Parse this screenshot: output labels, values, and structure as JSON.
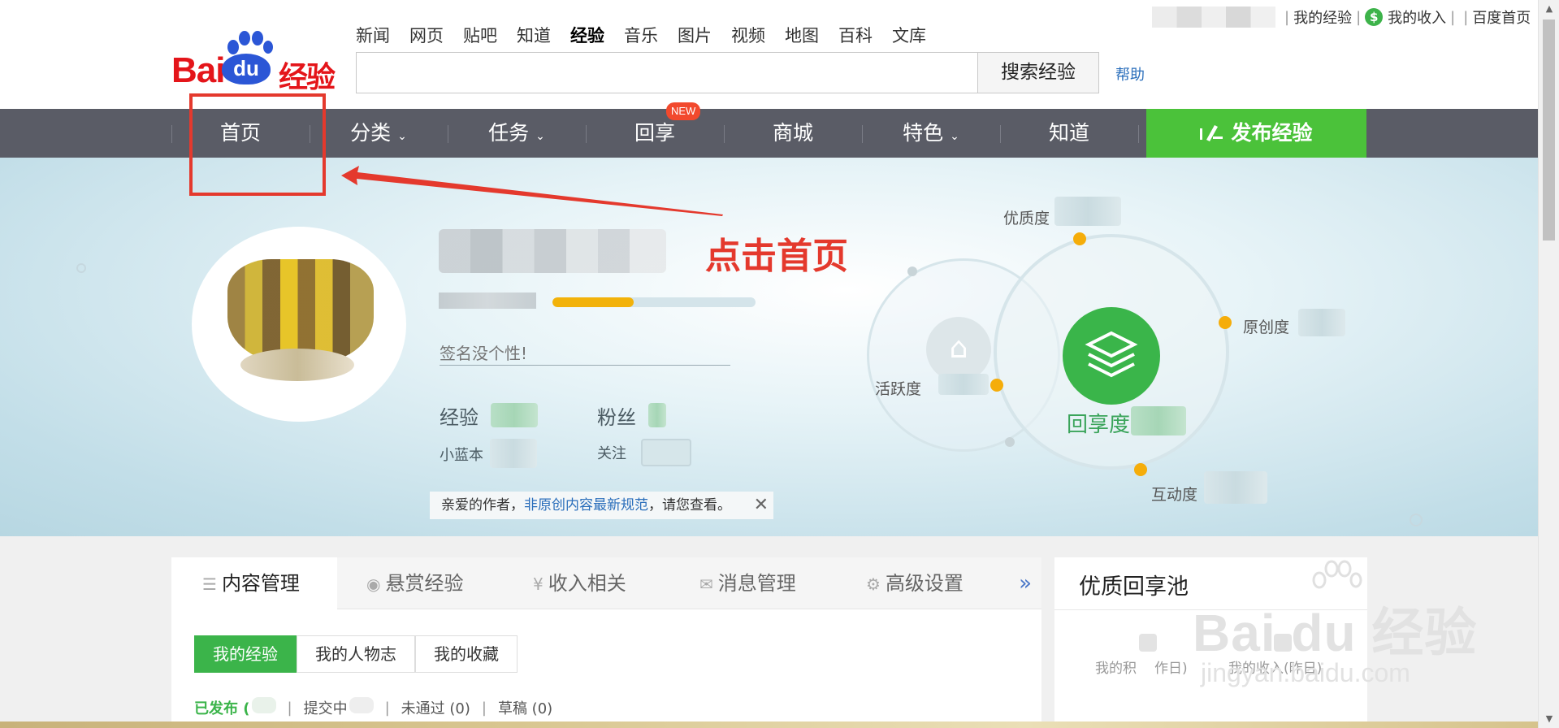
{
  "header": {
    "logo_bai": "Bai",
    "logo_du": "du",
    "logo_jingyan": "经验",
    "top_nav": [
      "新闻",
      "网页",
      "贴吧",
      "知道",
      "经验",
      "音乐",
      "图片",
      "视频",
      "地图",
      "百科",
      "文库"
    ],
    "active_top_nav": "经验",
    "search_placeholder": "",
    "search_button": "搜索经验",
    "help_link": "帮助",
    "user_links": {
      "my_experience": "我的经验",
      "my_income": "我的收入",
      "baidu_home": "百度首页",
      "dollar_glyph": "$"
    }
  },
  "main_nav": {
    "items": [
      "首页",
      "分类",
      "任务",
      "回享",
      "商城",
      "特色",
      "知道"
    ],
    "new_badge": "NEW",
    "publish_button": "发布经验"
  },
  "profile": {
    "level_progress_percent": 40,
    "signature_placeholder": "签名没个性!",
    "experience_label": "经验",
    "fans_label": "粉丝",
    "notebook_label": "小蓝本",
    "follow_label": "关注",
    "notice_prefix": "亲爱的作者，",
    "notice_link": "非原创内容最新规范",
    "notice_suffix": "，请您查看。",
    "notice_close": "✕"
  },
  "annotation": {
    "text": "点击首页"
  },
  "orbit": {
    "quality": "优质度",
    "originality": "原创度",
    "activity": "活跃度",
    "interaction": "互动度",
    "center": "回享度"
  },
  "content_panel": {
    "tabs": [
      "内容管理",
      "悬赏经验",
      "收入相关",
      "消息管理",
      "高级设置"
    ],
    "tab_icons": [
      "☰",
      "◉",
      "¥",
      "✉",
      "⚙"
    ],
    "more": "»",
    "subtabs": [
      "我的经验",
      "我的人物志",
      "我的收藏"
    ],
    "filters": {
      "published": "已发布 (",
      "submitting": "提交中",
      "rejected": "未通过 (0)",
      "draft": "草稿 (0)"
    }
  },
  "pool_panel": {
    "title": "优质回享池",
    "stat_left": "我的积",
    "stat_left_suffix": "作日)",
    "stat_right": "我的收入(昨日)"
  },
  "watermark": {
    "line1": "Bai du 经验",
    "line2": "jingyan.baidu.com"
  },
  "colors": {
    "nav_bg": "#5a5c66",
    "publish_green": "#4bc23a",
    "brand_red": "#e4151a",
    "brand_blue": "#2b56d6",
    "annotation_red": "#e4392d",
    "progress_orange": "#f2b20a"
  }
}
